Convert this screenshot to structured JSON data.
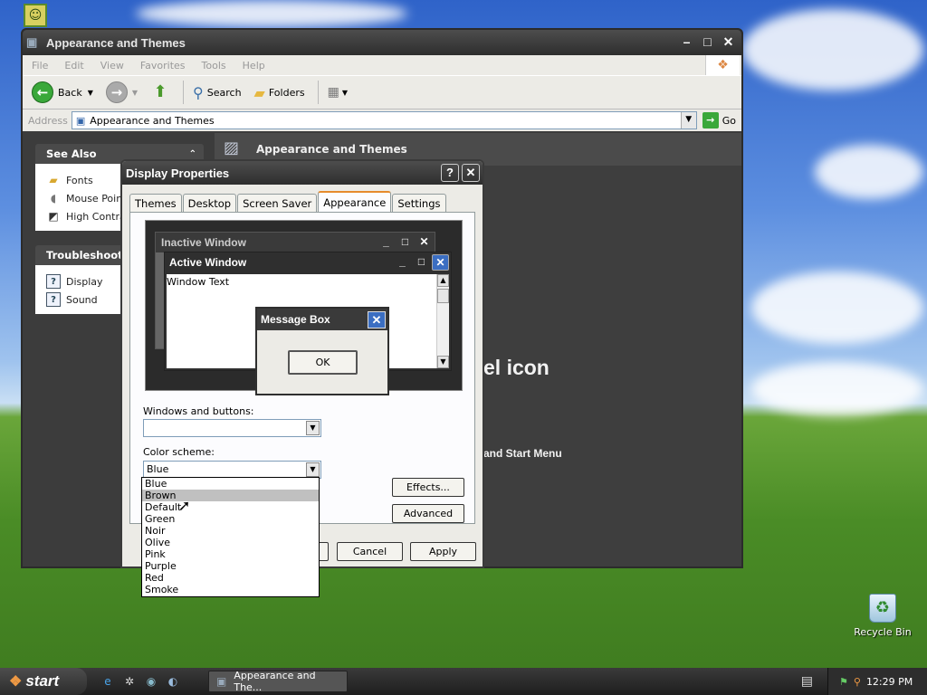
{
  "desktop": {
    "recycle_bin_label": "Recycle Bin"
  },
  "explorer": {
    "title": "Appearance and Themes",
    "menu": [
      "File",
      "Edit",
      "View",
      "Favorites",
      "Tools",
      "Help"
    ],
    "toolbar": {
      "back": "Back",
      "search": "Search",
      "folders": "Folders"
    },
    "address": {
      "label": "Address",
      "value": "Appearance and Themes",
      "go": "Go"
    },
    "see_also": {
      "title": "See Also",
      "items": [
        "Fonts",
        "Mouse Pointers",
        "High Contrast"
      ]
    },
    "troubleshooters": {
      "title": "Troubleshooters",
      "items": [
        "Display",
        "Sound"
      ]
    },
    "main_heading": "Appearance and Themes",
    "main_big_text": "el icon",
    "main_small_text": "and Start Menu"
  },
  "dialog": {
    "title": "Display Properties",
    "tabs": [
      "Themes",
      "Desktop",
      "Screen Saver",
      "Appearance",
      "Settings"
    ],
    "active_tab": "Appearance",
    "preview": {
      "inactive_title": "Inactive Window",
      "active_title": "Active Window",
      "window_text": "Window Text",
      "message_box_title": "Message Box",
      "ok": "OK"
    },
    "windows_buttons_label": "Windows and buttons:",
    "windows_buttons_value": "",
    "color_scheme_label": "Color scheme:",
    "color_scheme_value": "Blue",
    "color_scheme_options": [
      "Blue",
      "Brown",
      "Default",
      "Green",
      "Noir",
      "Olive",
      "Pink",
      "Purple",
      "Red",
      "Smoke"
    ],
    "highlighted_option": "Brown",
    "effects_button": "Effects...",
    "advanced_button": "Advanced",
    "cancel_button": "Cancel",
    "apply_button": "Apply"
  },
  "taskbar": {
    "start": "start",
    "task_label": "Appearance and The...",
    "clock": "12:29 PM"
  }
}
